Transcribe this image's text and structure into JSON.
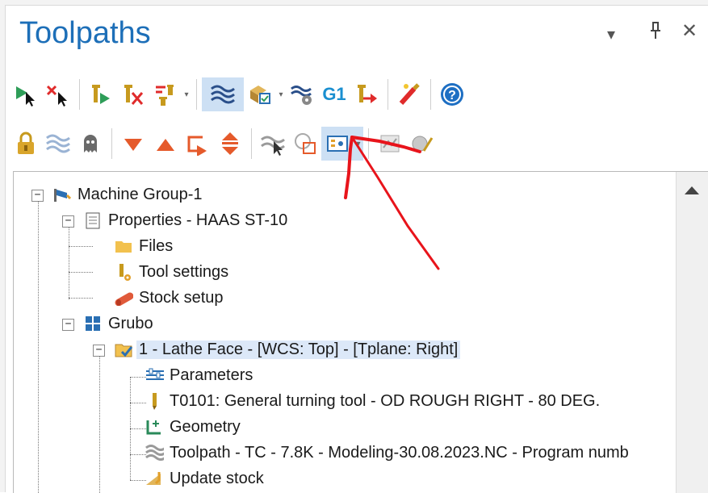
{
  "panel": {
    "title": "Toolpaths",
    "controls": {
      "menu": "▾",
      "pin": "⊥",
      "close": "✕"
    }
  },
  "toolbar_row1": {
    "items": [
      "select-all-operations-icon",
      "select-all-dirty-operations-icon",
      "regenerate-selected-icon",
      "regenerate-all-dirty-icon",
      "toggle-posting-icon",
      "backplot-icon",
      "verify-icon",
      "simulate-icon",
      "g1-post-icon",
      "move-insert-arrow-icon",
      "edit-tool-icon",
      "help-icon"
    ],
    "g1_label": "G1"
  },
  "toolbar_row2": {
    "items": [
      "lock-icon",
      "toggle-display-icon",
      "ghost-icon",
      "move-down-icon",
      "move-up-icon",
      "insert-after-icon",
      "scroll-to-insert-icon",
      "hide-toolpath-icon",
      "select-region-icon",
      "display-options-icon",
      "stock-icon",
      "shaded-icon"
    ]
  },
  "tree": {
    "machine_group": "Machine Group-1",
    "properties": "Properties - HAAS ST-10",
    "files": "Files",
    "tool_settings": "Tool settings",
    "stock_setup": "Stock setup",
    "group": "Grubo",
    "operation": "1 - Lathe Face - [WCS: Top] - [Tplane: Right]",
    "parameters": "Parameters",
    "tool": "T0101: General turning tool - OD ROUGH RIGHT - 80 DEG.",
    "geometry": "Geometry",
    "toolpath": "Toolpath - TC - 7.8K - Modeling-30.08.2023.NC - Program numb",
    "update_stock": "Update stock"
  },
  "colors": {
    "title": "#1d6fb8",
    "selection": "#cde0f4",
    "annotation_arrow": "#e8141b"
  }
}
